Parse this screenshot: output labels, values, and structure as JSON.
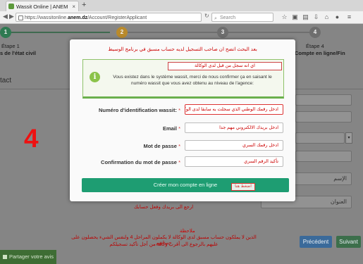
{
  "browser": {
    "tab_title": "Wassit Online | ANEM",
    "tab_close": "×",
    "new_tab": "+",
    "url_prefix": "https://wassitonline.",
    "url_domain": "anem.dz",
    "url_path": "/Account/RegisterApplicant",
    "search_placeholder": "Search",
    "icons": [
      "star-icon",
      "reading-list-icon",
      "lock-icon",
      "download-icon",
      "home-icon",
      "chat-icon",
      "menu-icon"
    ]
  },
  "steps": [
    {
      "number": "1",
      "label": "Étape 1",
      "sub": "s de l'état civil",
      "color": "#2f7a52"
    },
    {
      "number": "2",
      "label": "",
      "sub": "",
      "color": "#b98a2c"
    },
    {
      "number": "3",
      "label": "",
      "sub": "",
      "color": "#7a7a7a"
    },
    {
      "number": "4",
      "label": "Étape 4",
      "sub": "Compte en ligne/Fin",
      "color": "#7a7a7a"
    }
  ],
  "background": {
    "section_title": "tact",
    "big_number": "4",
    "name_field_label": "الإسم",
    "address_field_label": "العنوان",
    "select_arrow": "▾",
    "prev_button": "Précédent",
    "next_button": "Suivant",
    "share_button": "Partager votre avis",
    "note_title": "ملاحظة",
    "note_line1": "الذين لا يملكون حساب مسبق لدى الوكالة لا يكملون المراحل 4 ولنفس الشيء يحصلون على حسابهم",
    "note_line2": "عليهم بالرجوع الى أقرب وكالة من أجل تأكيد تسجيلكم"
  },
  "modal": {
    "title_ar": "بعد البحث اتضح ان صاحب التسجيل لديه حساب مسبق في برنامج الوسيط",
    "info_ar": "اي انه سجل من قبل لدى الوكالة",
    "info_icon": "i",
    "info_fr": "Vous existez dans le système wassit, merci de nous confirmer ça en saisant le numéro wassit que vous avez obtenu au niveau de l'agence:",
    "required_mark": "*",
    "fields": [
      {
        "label": "Numéro d'identification wassit:",
        "value": "ادخل رقمك الوطني الذي سجلت به سابقا لدى الوكالة"
      },
      {
        "label": "Email",
        "value": "ادخل بريدك الالكتروني  مهم جدا"
      },
      {
        "label": "Mot de passe",
        "value": "ادخل رقمك السري"
      },
      {
        "label": "Confirmation du mot de passe",
        "value": "تأكيد الرقم السري"
      }
    ],
    "create_button": "Créer mon compte en ligne",
    "create_tag": "اضغط هنا",
    "after_note": "ارجع الى بريدك وفعل حسابك"
  },
  "colors": {
    "create_button": "#1e9d72",
    "info_border": "#6ab04c",
    "annotation_red": "#cc0000",
    "prev_button": "#3a6a9a",
    "next_button": "#3c6f4b"
  }
}
